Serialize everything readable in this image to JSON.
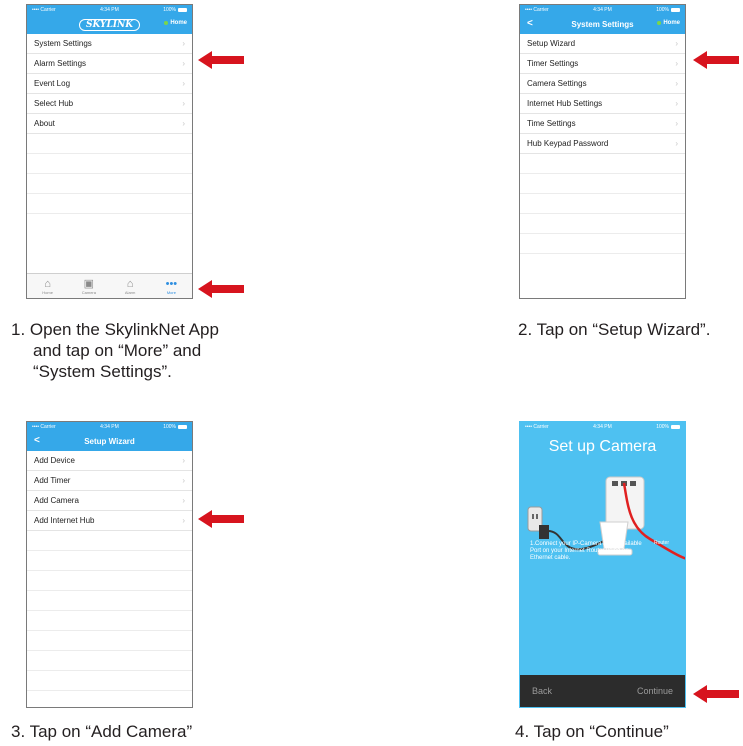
{
  "panel1": {
    "status": {
      "carrier": "•••• Carrier",
      "time": "4:34 PM",
      "battery": "100%"
    },
    "logo": "SKYLINK",
    "home_label": "Home",
    "menu": [
      "System Settings",
      "Alarm Settings",
      "Event Log",
      "Select Hub",
      "About"
    ],
    "tabs": [
      {
        "label": "Home",
        "icon": "home-icon"
      },
      {
        "label": "Camera",
        "icon": "camera-icon"
      },
      {
        "label": "Alarm",
        "icon": "alarm-icon"
      },
      {
        "label": "More",
        "icon": "more-icon"
      }
    ],
    "caption_lines": [
      "1. Open the SkylinkNet App",
      "and tap on “More” and",
      "“System Settings”."
    ]
  },
  "panel2": {
    "status": {
      "carrier": "•••• Carrier",
      "time": "4:34 PM",
      "battery": "100%"
    },
    "title": "System Settings",
    "back": "<",
    "home_label": "Home",
    "menu": [
      "Setup Wizard",
      "Timer Settings",
      "Camera Settings",
      "Internet Hub Settings",
      "Time Settings",
      "Hub Keypad Password"
    ],
    "caption": "2. Tap on “Setup Wizard”."
  },
  "panel3": {
    "status": {
      "carrier": "•••• Carrier",
      "time": "4:34 PM",
      "battery": "100%"
    },
    "title": "Setup Wizard",
    "back": "<",
    "menu": [
      "Add Device",
      "Add Timer",
      "Add Camera",
      "Add Internet Hub"
    ],
    "caption": "3. Tap on “Add Camera”"
  },
  "panel4": {
    "status": {
      "carrier": "•••• Carrier",
      "time": "4:34 PM",
      "battery": "100%"
    },
    "title": "Set up Camera",
    "router_label": "Router",
    "description": "1.Connect your IP-Camera to an available Port on your Internet Router using an Ethernet cable.",
    "back": "Back",
    "continue": "Continue",
    "caption": "4. Tap on “Continue”"
  },
  "colors": {
    "accent": "#35a8e9",
    "arrow": "#d7141e",
    "camera_bg": "#4ec1f1",
    "bottom_bar": "#2c2c2c"
  }
}
